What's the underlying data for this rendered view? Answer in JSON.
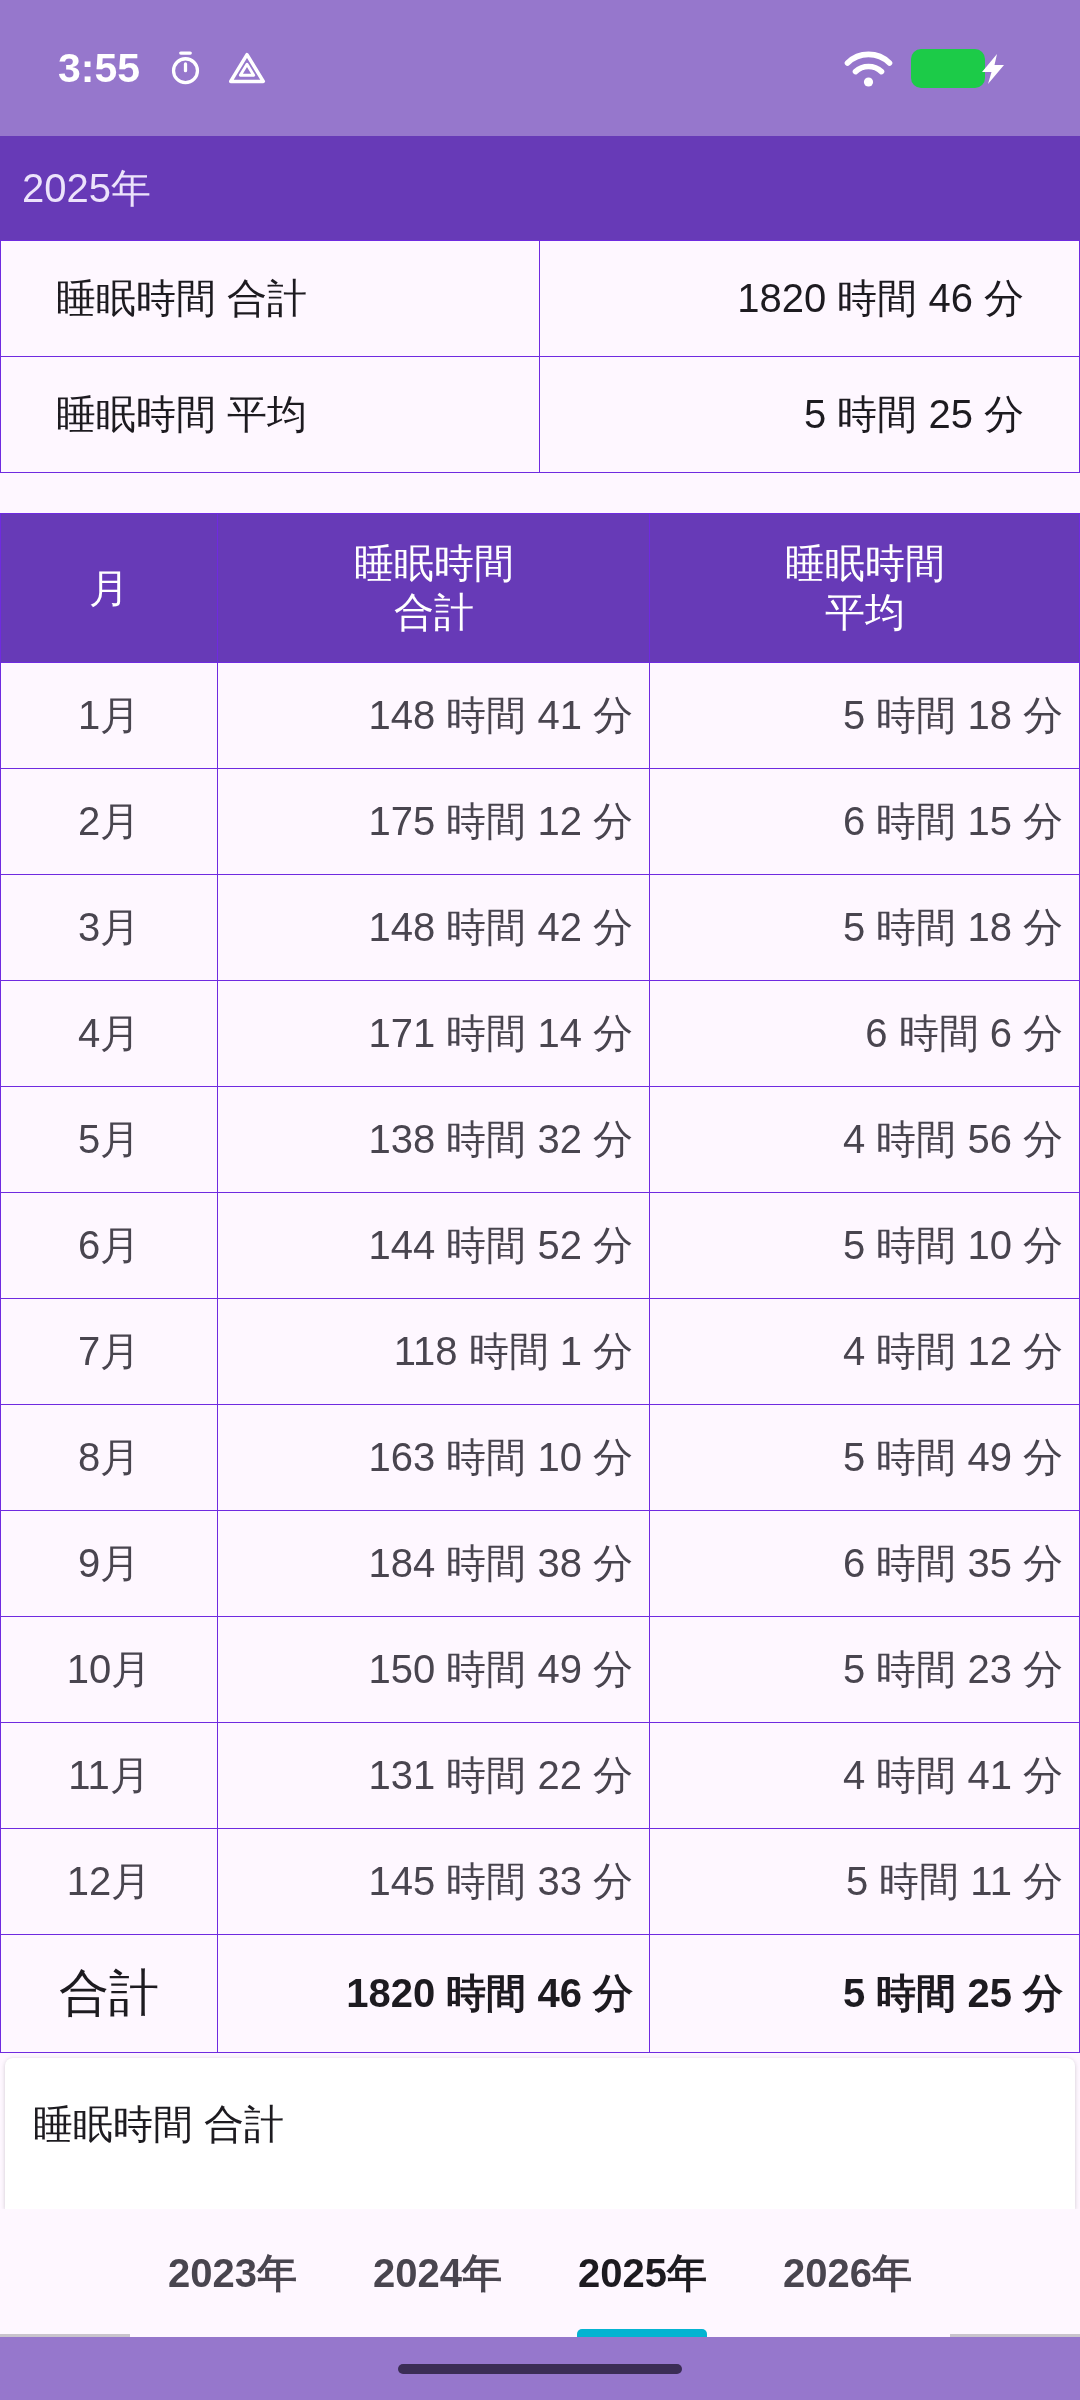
{
  "status_bar": {
    "time": "3:55"
  },
  "app_bar": {
    "title": "2025年"
  },
  "summary": {
    "rows": [
      {
        "label": "睡眠時間 合計",
        "value": "1820 時間 46 分"
      },
      {
        "label": "睡眠時間 平均",
        "value": "5 時間 25 分"
      }
    ]
  },
  "table": {
    "columns": [
      {
        "lines": [
          "月"
        ]
      },
      {
        "lines": [
          "睡眠時間",
          "合計"
        ]
      },
      {
        "lines": [
          "睡眠時間",
          "平均"
        ]
      }
    ],
    "rows": [
      {
        "month": "1月",
        "total": "148 時間 41 分",
        "average": "5 時間 18 分"
      },
      {
        "month": "2月",
        "total": "175 時間 12 分",
        "average": "6 時間 15 分"
      },
      {
        "month": "3月",
        "total": "148 時間 42 分",
        "average": "5 時間 18 分"
      },
      {
        "month": "4月",
        "total": "171 時間 14 分",
        "average": "6 時間 6 分"
      },
      {
        "month": "5月",
        "total": "138 時間 32 分",
        "average": "4 時間 56 分"
      },
      {
        "month": "6月",
        "total": "144 時間 52 分",
        "average": "5 時間 10 分"
      },
      {
        "month": "7月",
        "total": "118 時間 1 分",
        "average": "4 時間 12 分"
      },
      {
        "month": "8月",
        "total": "163 時間 10 分",
        "average": "5 時間 49 分"
      },
      {
        "month": "9月",
        "total": "184 時間 38 分",
        "average": "6 時間 35 分"
      },
      {
        "month": "10月",
        "total": "150 時間 49 分",
        "average": "5 時間 23 分"
      },
      {
        "month": "11月",
        "total": "131 時間 22 分",
        "average": "4 時間 41 分"
      },
      {
        "month": "12月",
        "total": "145 時間 33 分",
        "average": "5 時間 11 分"
      }
    ],
    "totals": {
      "label": "合計",
      "total": "1820 時間 46 分",
      "average": "5 時間 25 分"
    }
  },
  "card": {
    "title": "睡眠時間 合計"
  },
  "tabs": [
    {
      "label": "2023年",
      "selected": false
    },
    {
      "label": "2024年",
      "selected": false
    },
    {
      "label": "2025年",
      "selected": true
    },
    {
      "label": "2026年",
      "selected": false
    }
  ]
}
